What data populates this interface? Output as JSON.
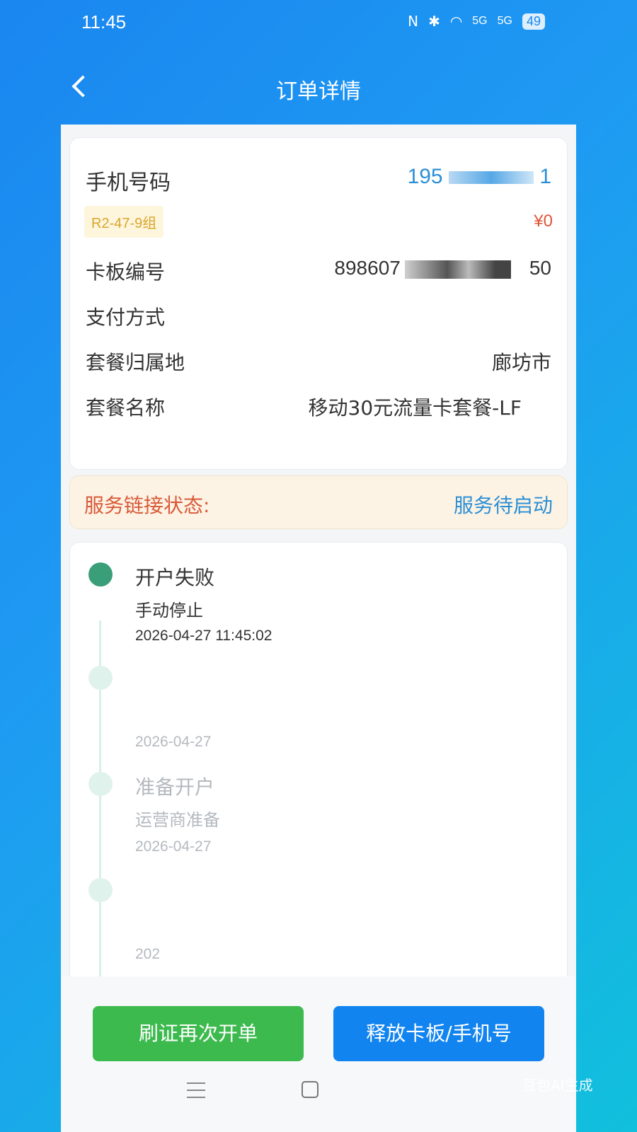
{
  "status_bar": {
    "time": "11:45",
    "signal1": "5G",
    "signal2": "5G",
    "battery": "49"
  },
  "nav": {
    "title": "订单详情"
  },
  "info": {
    "phone_label": "手机号码",
    "phone_value_prefix": "195",
    "phone_value_suffix": "1",
    "group_badge": "R2-47-9组",
    "price": "¥0",
    "board_label": "卡板编号",
    "board_value_prefix": "898607",
    "board_value_suffix": "50",
    "payment_label": "支付方式",
    "payment_value": "",
    "location_label": "套餐归属地",
    "location_value": "廊坊市",
    "package_label": "套餐名称",
    "package_value": "移动30元流量卡套餐-LF"
  },
  "service": {
    "label": "服务链接状态:",
    "value": "服务待启动"
  },
  "timeline": [
    {
      "title": "开户失败",
      "desc": "手动停止",
      "time": "2026-04-27 11:45:02"
    },
    {
      "title": "",
      "desc": "",
      "time": "2026-04-27"
    },
    {
      "title": "准备开户",
      "desc": "运营商准备",
      "time": "2026-04-27"
    },
    {
      "title": "",
      "desc": "",
      "time": "202"
    }
  ],
  "actions": {
    "reissue": "刷证再次开单",
    "release": "释放卡板/手机号"
  },
  "watermark": "豆包AI生成",
  "colors": {
    "accent_blue": "#1284f0",
    "accent_green": "#3dba4e",
    "status_red": "#d95a3a",
    "timeline_active": "#3a9e78"
  }
}
